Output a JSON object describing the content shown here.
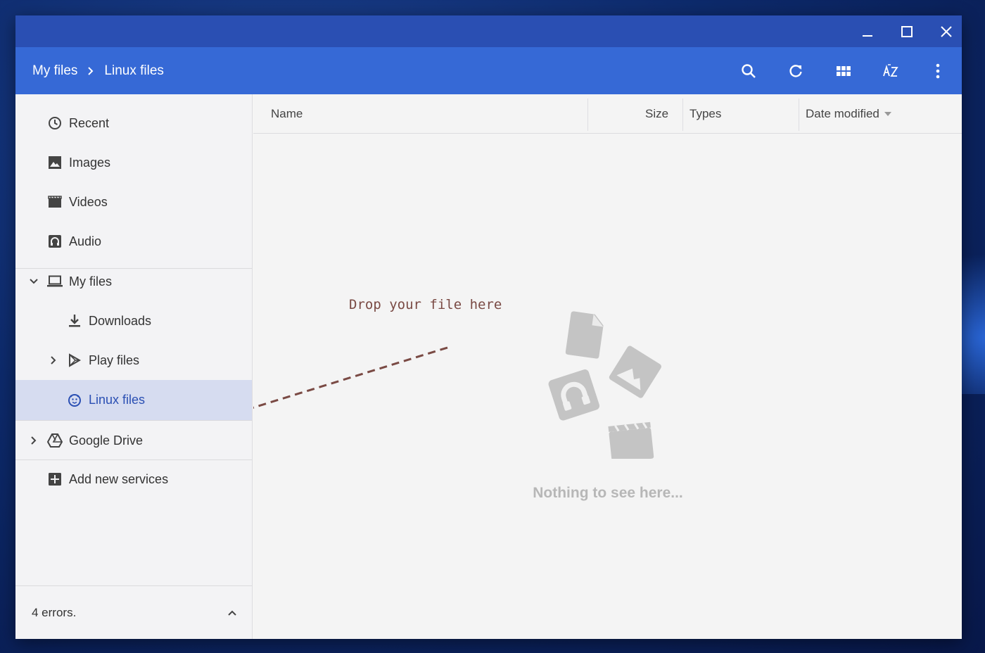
{
  "window": {
    "controls": [
      "minimize-icon",
      "maximize-icon",
      "close-icon"
    ]
  },
  "toolbar": {
    "breadcrumb": [
      "My files",
      "Linux files"
    ],
    "actions": [
      "search-icon",
      "refresh-icon",
      "grid-view-icon",
      "sort-az-icon",
      "more-vert-icon"
    ]
  },
  "sidebar": {
    "items": [
      {
        "label": "Recent",
        "icon": "clock-icon"
      },
      {
        "label": "Images",
        "icon": "image-icon"
      },
      {
        "label": "Videos",
        "icon": "film-icon"
      },
      {
        "label": "Audio",
        "icon": "headphones-icon"
      },
      {
        "label": "My files",
        "icon": "laptop-icon",
        "expanded": true
      },
      {
        "label": "Downloads",
        "icon": "download-icon"
      },
      {
        "label": "Play files",
        "icon": "play-store-icon",
        "expanded": false
      },
      {
        "label": "Linux files",
        "icon": "linux-icon",
        "selected": true
      },
      {
        "label": "Google Drive",
        "icon": "drive-icon",
        "expanded": false
      },
      {
        "label": "Add new services",
        "icon": "add-services-icon"
      }
    ],
    "status": "4 errors."
  },
  "main": {
    "columns": [
      "Name",
      "Size",
      "Types",
      "Date modified"
    ],
    "sort_column": "Date modified",
    "drop_hint": "Drop your file here",
    "empty_message": "Nothing to see here..."
  },
  "colors": {
    "titlebar": "#2a4fb3",
    "toolbar": "#3669d6",
    "selected_bg": "#d6dcf0",
    "selected_text": "#2a4fb3",
    "hint": "#7a4a44"
  }
}
